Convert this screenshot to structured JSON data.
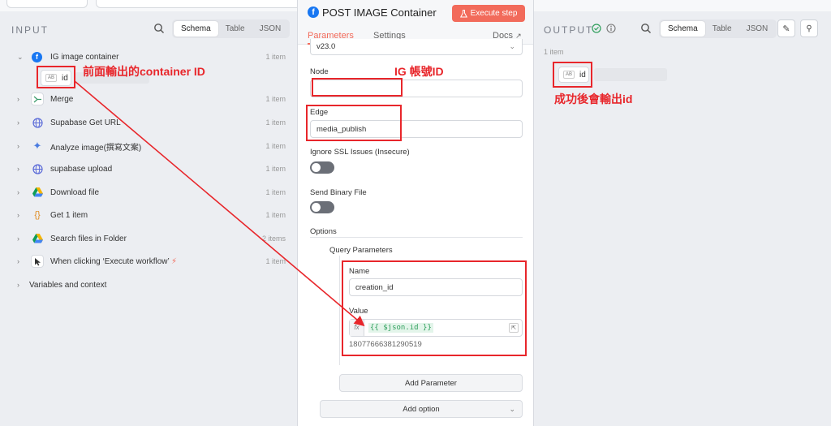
{
  "input_panel": {
    "title": "INPUT",
    "view_tabs": [
      "Schema",
      "Table",
      "JSON"
    ],
    "active_view": "Schema",
    "nodes": [
      {
        "label": "IG image container",
        "count": "1 item",
        "icon": "facebook-icon",
        "expanded": true
      },
      {
        "label": "Merge",
        "count": "1 item",
        "icon": "merge-icon"
      },
      {
        "label": "Supabase Get URL",
        "count": "1 item",
        "icon": "globe-icon"
      },
      {
        "label": "Analyze image(撰寫文案)",
        "count": "1 item",
        "icon": "sparkle-icon"
      },
      {
        "label": "supabase upload",
        "count": "1 item",
        "icon": "globe-icon"
      },
      {
        "label": "Download file",
        "count": "1 item",
        "icon": "google-drive-icon"
      },
      {
        "label": "Get 1 item",
        "count": "1 item",
        "icon": "braces-icon"
      },
      {
        "label": "Search files in Folder",
        "count": "2 items",
        "icon": "google-drive-icon"
      },
      {
        "label": "When clicking ‘Execute workflow’",
        "count": "1 item",
        "icon": "cursor-icon"
      }
    ],
    "field_id": {
      "type": "AB",
      "name": "id"
    },
    "variables_label": "Variables and context"
  },
  "node_panel": {
    "title": "POST IMAGE Container",
    "execute_label": "Execute step",
    "tabs": [
      "Parameters",
      "Settings"
    ],
    "active_tab": "Parameters",
    "docs_label": "Docs",
    "version_value": "v23.0",
    "node_label": "Node",
    "node_value": "",
    "edge_label": "Edge",
    "edge_value": "media_publish",
    "ssl_label": "Ignore SSL Issues (Insecure)",
    "ssl_on": false,
    "binary_label": "Send Binary File",
    "binary_on": false,
    "options_label": "Options",
    "query_params_label": "Query Parameters",
    "name_label": "Name",
    "name_value": "creation_id",
    "value_label": "Value",
    "fx_label": "fx",
    "value_expression": "{{ $json.id }}",
    "value_preview": "18077666381290519",
    "add_parameter_label": "Add Parameter",
    "add_option_label": "Add option"
  },
  "output_panel": {
    "title": "OUTPUT",
    "view_tabs": [
      "Schema",
      "Table",
      "JSON"
    ],
    "active_view": "Schema",
    "item_count": "1 item",
    "field_id": {
      "type": "AB",
      "name": "id"
    }
  },
  "annotations": {
    "container_id": "前面輸出的container ID",
    "ig_account_id": "IG 帳號ID",
    "success_output_id": "成功後會輸出id"
  },
  "colors": {
    "accent": "#f26b5b",
    "annotation_red": "#e8262b",
    "facebook_blue": "#1877f2",
    "expression_green": "#2e9e5b"
  }
}
